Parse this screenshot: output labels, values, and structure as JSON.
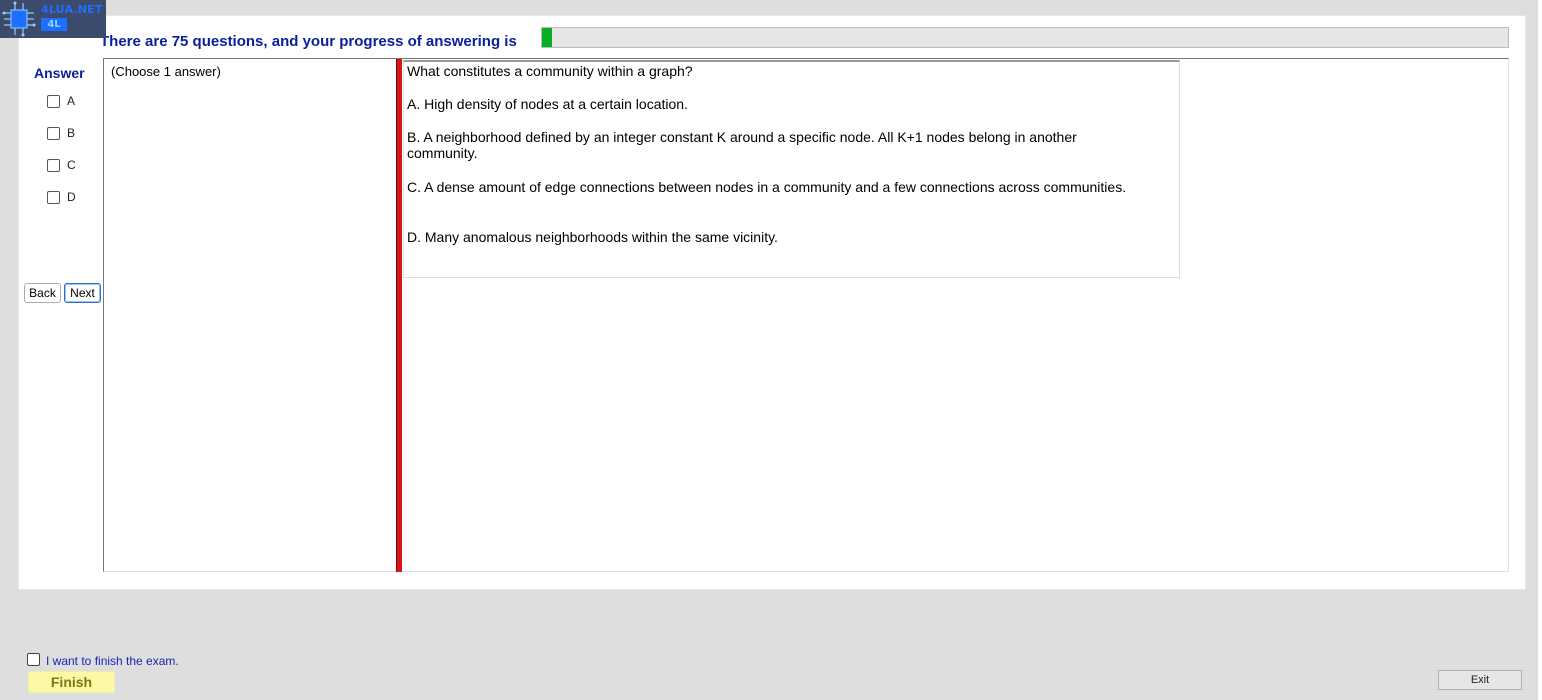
{
  "logo": {
    "name": "4LUA.NET",
    "sub": "4L"
  },
  "progress": {
    "caption": "There are 75 questions, and your progress of answering is",
    "fraction": 0.01,
    "fill_color": "#06b025"
  },
  "answer_panel": {
    "heading": "Answer",
    "options": [
      "A",
      "B",
      "C",
      "D"
    ],
    "back_label": "Back",
    "next_label": "Next"
  },
  "question": {
    "instruction": "(Choose 1 answer)",
    "stem": "What constitutes a community within a graph?",
    "choices": [
      "A.  High density of nodes at a certain location.",
      "B.  A neighborhood defined by an integer constant K around a specific node. All K+1 nodes belong in another community.",
      "C.  A dense amount of edge connections between nodes in a community and a few connections across communities.",
      "D.  Many anomalous neighborhoods within the same vicinity."
    ]
  },
  "footer": {
    "finish_check_label": "I want to finish the exam.",
    "finish_label": "Finish",
    "exit_label": "Exit"
  },
  "colors": {
    "heading_blue": "#0a1f9c",
    "splitter_red": "#d6161a",
    "finish_yellow": "#fcf8a6"
  }
}
